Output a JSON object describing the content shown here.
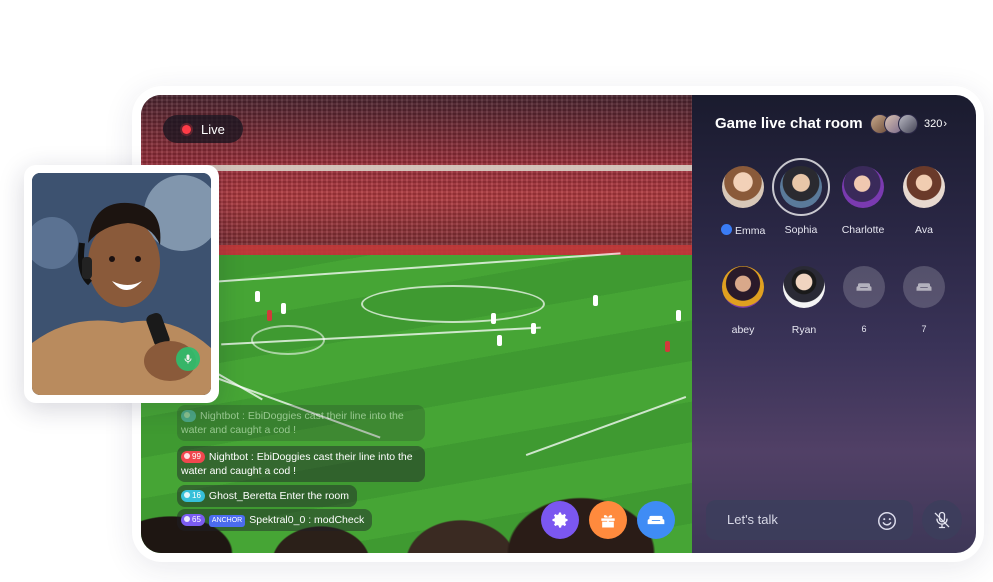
{
  "video": {
    "live_label": "Live",
    "messages": [
      {
        "level": "",
        "level_color": "#5ab5e8",
        "anchor": "",
        "text": "Nightbot : EbiDoggies cast their line into the water and caught a cod !",
        "faded": true
      },
      {
        "level": "99",
        "level_color": "#f0474e",
        "anchor": "",
        "text": "Nightbot : EbiDoggies cast their line into the water and caught a cod !",
        "faded": false
      },
      {
        "level": "16",
        "level_color": "#36c0d9",
        "anchor": "",
        "text": "Ghost_Beretta Enter the room",
        "faded": false
      },
      {
        "level": "65",
        "level_color": "#7a5cf0",
        "anchor": "ANCHOR",
        "text": "Spektral0_0 : modCheck",
        "faded": false
      }
    ],
    "buttons": [
      {
        "name": "settings",
        "icon": "gear-icon",
        "color": "#7b57f0"
      },
      {
        "name": "gift",
        "icon": "gift-icon",
        "color": "#ff8a3d"
      },
      {
        "name": "seat",
        "icon": "sofa-icon",
        "color": "#3f8cf5"
      }
    ]
  },
  "chat_room": {
    "title": "Game live chat room",
    "viewer_count": "320",
    "seats": [
      {
        "name": "Emma",
        "badge": true
      },
      {
        "name": "Sophia",
        "badge": false
      },
      {
        "name": "Charlotte",
        "badge": false
      },
      {
        "name": "Ava",
        "badge": false
      },
      {
        "name": "abey",
        "badge": false
      },
      {
        "name": "Ryan",
        "badge": false
      },
      {
        "name": "6",
        "badge": false
      },
      {
        "name": "7",
        "badge": false
      }
    ],
    "input_placeholder": "Let's talk"
  },
  "colors": {
    "live_dot": "#ff3b47",
    "panel_top": "#1a1b2e",
    "panel_bottom": "#514066",
    "mic_on": "#2dbf6e"
  }
}
